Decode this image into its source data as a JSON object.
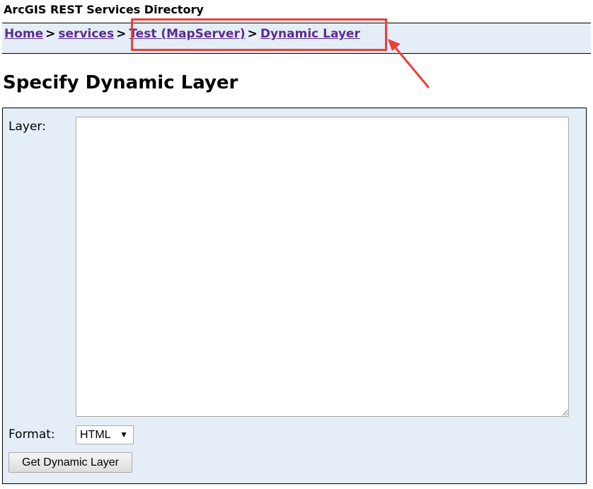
{
  "header": {
    "app_title": "ArcGIS REST Services Directory"
  },
  "breadcrumb": {
    "items": [
      {
        "label": "Home"
      },
      {
        "label": "services"
      },
      {
        "label": "Test (MapServer)"
      },
      {
        "label": "Dynamic Layer"
      }
    ],
    "separator": ">"
  },
  "page": {
    "title": "Specify Dynamic Layer"
  },
  "form": {
    "layer_label": "Layer:",
    "layer_value": "",
    "format_label": "Format:",
    "format_selected": "HTML",
    "submit_label": "Get Dynamic Layer"
  },
  "annotation": {
    "color": "#e8413b"
  },
  "colors": {
    "panel_background": "#e5eef7",
    "link": "#5b2c91"
  },
  "icons": {
    "select_caret": "triangle-down-icon",
    "resize_grip": "resize-grip-icon"
  }
}
